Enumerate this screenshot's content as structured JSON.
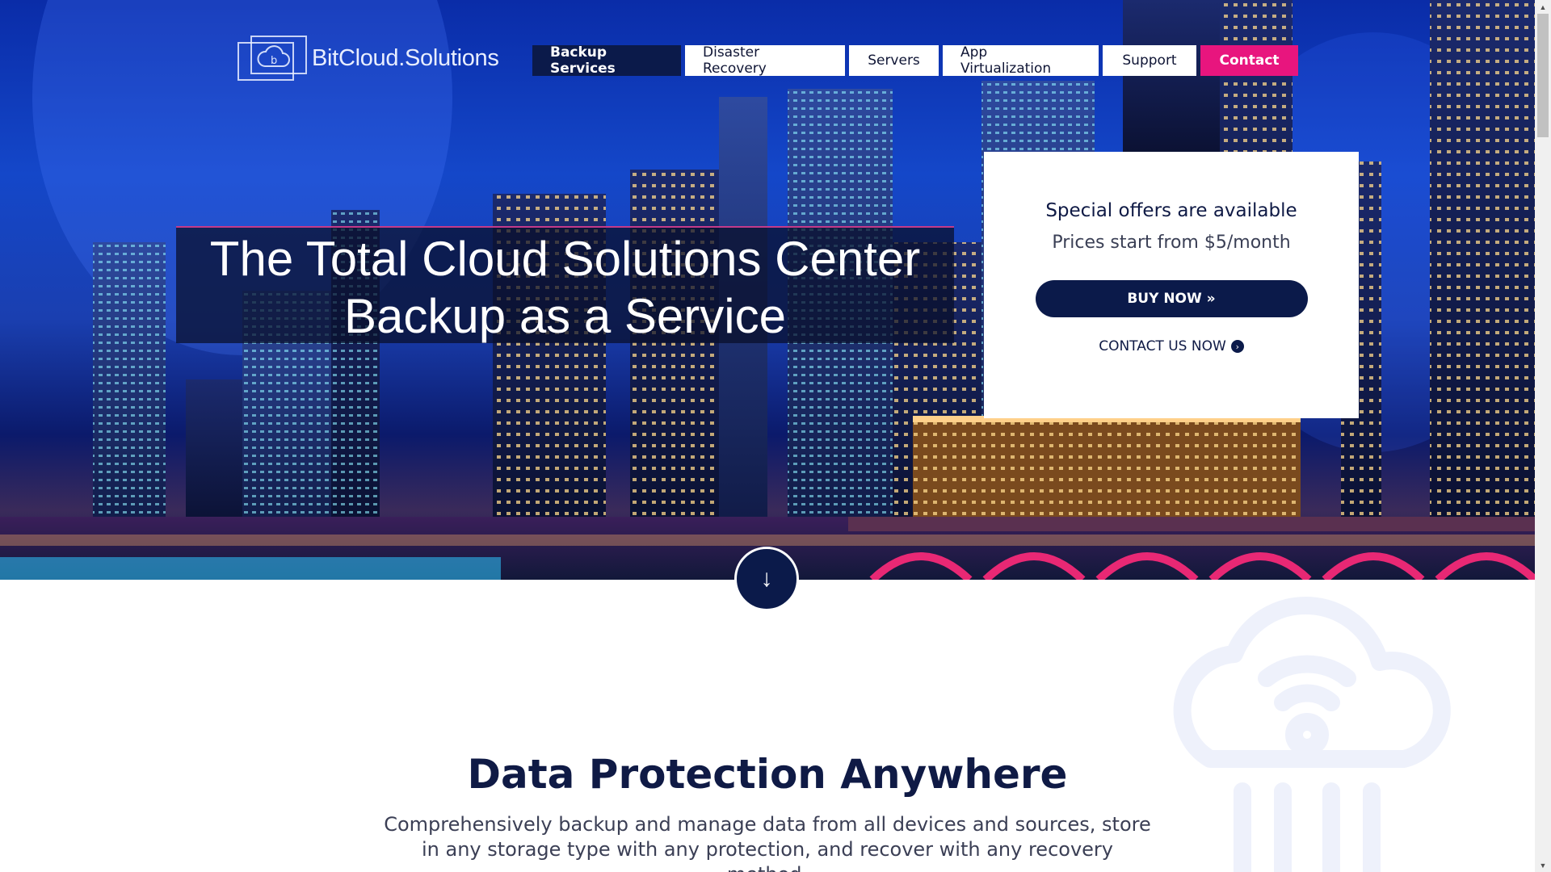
{
  "header": {
    "logo_text": "BitCloud.Solutions",
    "nav": [
      {
        "label": "Backup Services"
      },
      {
        "label": "Disaster Recovery"
      },
      {
        "label": "Servers"
      },
      {
        "label": "App Virtualization"
      },
      {
        "label": "Support"
      },
      {
        "label": "Contact"
      }
    ]
  },
  "hero": {
    "headline_line1": "The Total Cloud Solutions Center",
    "headline_line2": "Backup as a Service"
  },
  "offer": {
    "title": "Special offers are available",
    "subtitle": "Prices start from $5/month",
    "buy_label": "BUY NOW »",
    "contact_label": "CONTACT US NOW"
  },
  "section": {
    "title": "Data Protection Anywhere",
    "description": "Comprehensively backup and manage data from all devices and sources, store in any storage type with any protection, and recover with any recovery method."
  },
  "colors": {
    "navy": "#0b1a4a",
    "accent_pink": "#e8157e",
    "white": "#ffffff"
  },
  "icons": {
    "scroll_down": "arrow-down-icon",
    "contact_arrow": "circle-chevron-right-icon",
    "decorative": "cloud-wifi-icon"
  }
}
